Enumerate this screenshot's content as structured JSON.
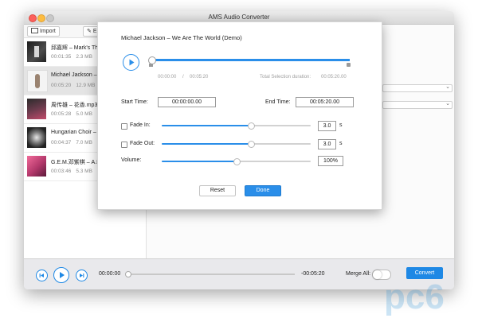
{
  "window": {
    "title": "AMS Audio Converter"
  },
  "toolbar": {
    "import_label": "Import",
    "edit_label": "E"
  },
  "tracks": [
    {
      "name": "邱嘉辉 – Mark's The",
      "duration": "00:01:35",
      "size": "2.3 MB"
    },
    {
      "name": "Michael Jackson – ..",
      "duration": "00:05:20",
      "size": "12.9 MB"
    },
    {
      "name": "周传雄 – 花香.mp3",
      "duration": "00:05:28",
      "size": "5.0 MB"
    },
    {
      "name": "Hungarian Choir – Fo",
      "duration": "00:04:37",
      "size": "7.0 MB"
    },
    {
      "name": "G.E.M.邓紫棋 – A.I.N",
      "duration": "00:03:46",
      "size": "5.3 MB"
    }
  ],
  "player": {
    "current_time": "00:00:00",
    "remaining_time": "-00:05:20",
    "merge_label": "Merge All:",
    "convert_label": "Convert"
  },
  "dialog": {
    "song_title": "Michael Jackson – We Are The World (Demo)",
    "playhead_start": "00:00:00",
    "separator": "/",
    "playhead_total": "00:05:20",
    "selection_label": "Total Selection duration:",
    "selection_value": "00:05:20.00",
    "start_label": "Start Time:",
    "start_value": "00:00:00.00",
    "end_label": "End Time:",
    "end_value": "00:05:20.00",
    "fade_in_label": "Fade In:",
    "fade_in_value": "3.0",
    "fade_in_unit": "s",
    "fade_in_level": 0.6,
    "fade_out_label": "Fade Out:",
    "fade_out_value": "3.0",
    "fade_out_unit": "s",
    "fade_out_level": 0.6,
    "volume_label": "Volume:",
    "volume_value": "100%",
    "volume_level": 0.5,
    "reset_label": "Reset",
    "done_label": "Done"
  },
  "colors": {
    "accent": "#2a8ee9",
    "convert_bg": "#1e88e5"
  }
}
